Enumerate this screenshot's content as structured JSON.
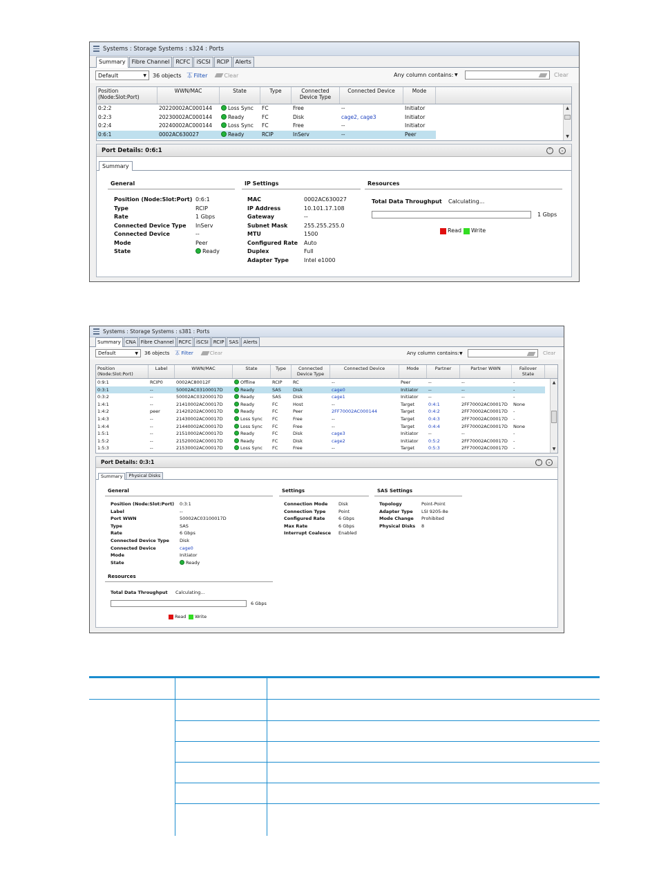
{
  "window1": {
    "title": "Systems : Storage Systems : s324 : Ports",
    "tabs": [
      "Summary",
      "Fibre Channel",
      "RCFC",
      "iSCSI",
      "RCIP",
      "Alerts"
    ],
    "toolbar": {
      "view": "Default",
      "count": "36 objects",
      "filter": "Filter",
      "clear": "Clear",
      "any_column": "Any column contains:",
      "clear2": "Clear"
    },
    "grid": {
      "headers": [
        "Position\n(Node:Slot:Port)",
        "WWN/MAC",
        "State",
        "Type",
        "Connected\nDevice Type",
        "Connected Device",
        "Mode"
      ],
      "rows": [
        [
          "0:2:2",
          "20220002AC000144",
          "Loss Sync",
          "FC",
          "Free",
          "--",
          "Initiator"
        ],
        [
          "0:2:3",
          "20230002AC000144",
          "Ready",
          "FC",
          "Disk",
          "cage2, cage3",
          "Initiator"
        ],
        [
          "0:2:4",
          "20240002AC000144",
          "Loss Sync",
          "FC",
          "Free",
          "--",
          "Initiator"
        ],
        [
          "0:6:1",
          "0002AC630027",
          "Ready",
          "RCIP",
          "InServ",
          "--",
          "Peer"
        ]
      ]
    },
    "details": {
      "title": "Port Details: 0:6:1",
      "tabs": [
        "Summary"
      ],
      "general_title": "General",
      "general": [
        [
          "Position (Node:Slot:Port)",
          "0:6:1"
        ],
        [
          "Type",
          "RCIP"
        ],
        [
          "Rate",
          "1 Gbps"
        ],
        [
          "Connected Device Type",
          "InServ"
        ],
        [
          "Connected Device",
          "--"
        ],
        [
          "Mode",
          "Peer"
        ],
        [
          "State",
          "Ready"
        ]
      ],
      "ip_title": "IP Settings",
      "ip": [
        [
          "MAC",
          "0002AC630027"
        ],
        [
          "IP Address",
          "10.101.17.108"
        ],
        [
          "Gateway",
          "--"
        ],
        [
          "Subnet Mask",
          "255.255.255.0"
        ],
        [
          "MTU",
          "1500"
        ],
        [
          "Configured Rate",
          "Auto"
        ],
        [
          "Duplex",
          "Full"
        ],
        [
          "Adapter Type",
          "Intel e1000"
        ]
      ],
      "resources_title": "Resources",
      "throughput_label": "Total Data Throughput",
      "throughput_value": "Calculating...",
      "bar_max": "1 Gbps",
      "legend_read": "Read",
      "legend_write": "Write"
    }
  },
  "window2": {
    "title": "Systems : Storage Systems : s381 : Ports",
    "tabs": [
      "Summary",
      "CNA",
      "Fibre Channel",
      "RCFC",
      "iSCSI",
      "RCIP",
      "SAS",
      "Alerts"
    ],
    "toolbar": {
      "view": "Default",
      "count": "36 objects",
      "filter": "Filter",
      "clear": "Clear",
      "any_column": "Any column contains:",
      "clear2": "Clear"
    },
    "grid": {
      "headers": [
        "Position\n(Node:Slot:Port)",
        "Label",
        "WWN/MAC",
        "State",
        "Type",
        "Connected\nDevice Type",
        "Connected Device",
        "Mode",
        "Partner",
        "Partner WWN",
        "Failover\nState"
      ],
      "rows": [
        [
          "0:9:1",
          "RCIP0",
          "0002AC80012F",
          "Offline",
          "RCIP",
          "RC",
          "--",
          "Peer",
          "--",
          "--",
          "-"
        ],
        [
          "0:3:1",
          "--",
          "50002AC03100017D",
          "Ready",
          "SAS",
          "Disk",
          "cage0",
          "Initiator",
          "--",
          "--",
          "-"
        ],
        [
          "0:3:2",
          "--",
          "50002AC03200017D",
          "Ready",
          "SAS",
          "Disk",
          "cage1",
          "Initiator",
          "--",
          "--",
          "-"
        ],
        [
          "1:4:1",
          "--",
          "21410002AC00017D",
          "Ready",
          "FC",
          "Host",
          "--",
          "Target",
          "0:4:1",
          "2FF70002AC00017D",
          "None"
        ],
        [
          "1:4:2",
          "peer",
          "21420202AC00017D",
          "Ready",
          "FC",
          "Peer",
          "2FF70002AC000144",
          "Target",
          "0:4:2",
          "2FF70002AC00017D",
          "-"
        ],
        [
          "1:4:3",
          "--",
          "21430002AC00017D",
          "Loss Sync",
          "FC",
          "Free",
          "--",
          "Target",
          "0:4:3",
          "2FF70002AC00017D",
          "-"
        ],
        [
          "1:4:4",
          "--",
          "21440002AC00017D",
          "Loss Sync",
          "FC",
          "Free",
          "--",
          "Target",
          "0:4:4",
          "2FF70002AC00017D",
          "None"
        ],
        [
          "1:5:1",
          "--",
          "21510002AC00017D",
          "Ready",
          "FC",
          "Disk",
          "cage3",
          "Initiator",
          "--",
          "--",
          "-"
        ],
        [
          "1:5:2",
          "--",
          "21520002AC00017D",
          "Ready",
          "FC",
          "Disk",
          "cage2",
          "Initiator",
          "0:5:2",
          "2FF70002AC00017D",
          "-"
        ],
        [
          "1:5:3",
          "--",
          "21530002AC00017D",
          "Loss Sync",
          "FC",
          "Free",
          "--",
          "Target",
          "0:5:3",
          "2FF70002AC00017D",
          "-"
        ]
      ]
    },
    "details": {
      "title": "Port Details: 0:3:1",
      "tabs": [
        "Summary",
        "Physical Disks"
      ],
      "general_title": "General",
      "general": [
        [
          "Position (Node:Slot:Port)",
          "0:3:1"
        ],
        [
          "Label",
          "--"
        ],
        [
          "Port WWN",
          "50002AC03100017D"
        ],
        [
          "Type",
          "SAS"
        ],
        [
          "Rate",
          "6 Gbps"
        ],
        [
          "Connected Device Type",
          "Disk"
        ],
        [
          "Connected Device",
          "cage0"
        ],
        [
          "Mode",
          "Initiator"
        ],
        [
          "State",
          "Ready"
        ]
      ],
      "settings_title": "Settings",
      "settings": [
        [
          "Connection Mode",
          "Disk"
        ],
        [
          "Connection Type",
          "Point"
        ],
        [
          "Configured Rate",
          "6 Gbps"
        ],
        [
          "Max Rate",
          "6 Gbps"
        ],
        [
          "Interrupt Coalesce",
          "Enabled"
        ]
      ],
      "sas_title": "SAS Settings",
      "sas": [
        [
          "Topology",
          "Point-Point"
        ],
        [
          "Adapter Type",
          "LSI 9205-8e"
        ],
        [
          "Mode Change",
          "Prohibited"
        ],
        [
          "Physical Disks",
          "8"
        ]
      ],
      "resources_title": "Resources",
      "throughput_label": "Total Data Throughput",
      "throughput_value": "Calculating...",
      "bar_max": "6 Gbps",
      "legend_read": "Read",
      "legend_write": "Write"
    }
  }
}
